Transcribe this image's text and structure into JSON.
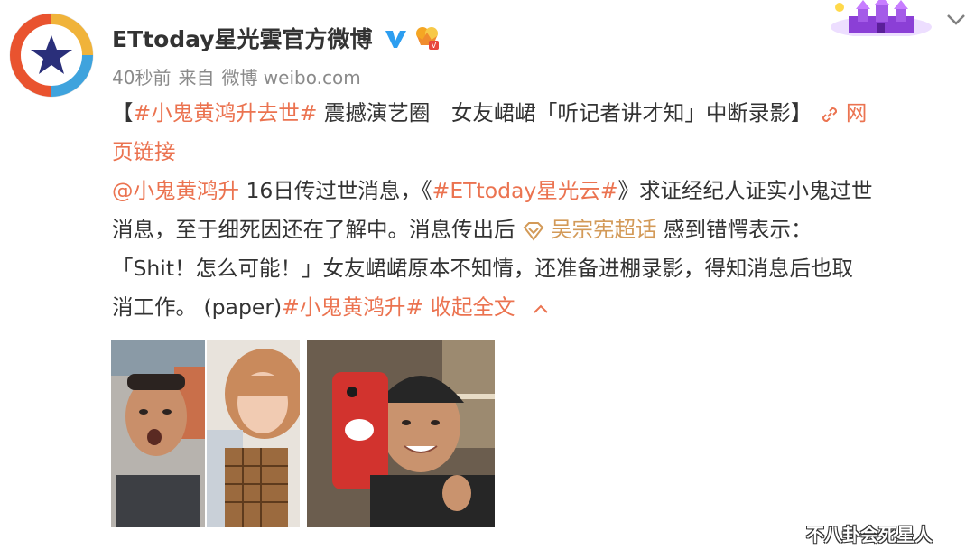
{
  "post": {
    "author": "ETtoday星光雲官方微博",
    "time": "40秒前",
    "source_prefix": "来自",
    "source": "微博 weibo.com",
    "lines": {
      "l1_open": "【",
      "l1_hashtag": "#小鬼黄鸿升去世#",
      "l1_text": " 震撼演艺圈　女友峮峮「听记者讲才知」中断录影】 ",
      "l1_link": "网",
      "l2_link": "页链接",
      "l3_mention": "@小鬼黄鸿升",
      "l3_text1": " 16日传过世消息，《",
      "l3_hashtag": "#ETtoday星光云#",
      "l3_text2": "》求证经纪人证实小鬼过世",
      "l4_text": "消息，至于细死因还在了解中。消息传出后 ",
      "l4_super": "吴宗宪超话",
      "l4_text2": " 感到错愕表示：",
      "l5_text": "「Shit！怎么可能！」女友峮峮原本不知情，还准备进棚录影，得知消息后也取",
      "l6_text": "消工作。 (paper)",
      "l6_hashtag": "#小鬼黄鸿升#",
      "l6_collapse": " 收起全文"
    }
  },
  "icons": {
    "avatar": "ettoday-star-logo",
    "verified": "verified-v-icon",
    "vip": "vip-crown-icon",
    "decoration": "castle-decoration",
    "menu": "chevron-down-icon",
    "link": "link-icon",
    "super_topic": "super-topic-icon",
    "collapse": "chevron-up-icon"
  },
  "colors": {
    "link": "#eb7350",
    "topic": "#d39a58",
    "meta": "#8a8a8a",
    "text": "#333333",
    "verify": "#2d9ef0"
  },
  "watermark": "不八卦会死星人"
}
